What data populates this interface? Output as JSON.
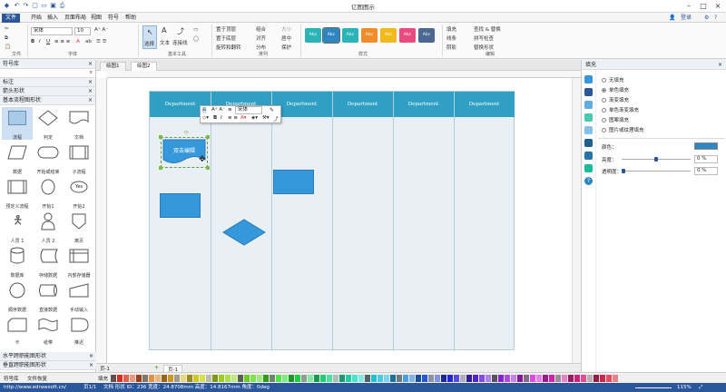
{
  "app": {
    "title": "亿图图示"
  },
  "menu": {
    "tabs": [
      "文件",
      "开始",
      "插入",
      "页面布局",
      "视图",
      "符号",
      "帮助"
    ],
    "login": "登录"
  },
  "ribbon": {
    "font_family": "宋体",
    "font_size": "10",
    "groups": [
      "文件",
      "字体",
      "基本工具",
      "排列",
      "样式",
      "编辑"
    ],
    "tools": {
      "select": "选择",
      "text": "文本",
      "connector": "连接线"
    },
    "arrange": [
      "置于顶层",
      "置于底层",
      "旋转和翻转",
      "组合",
      "对齐",
      "分布",
      "大小",
      "居中",
      "保护"
    ],
    "style_swatch_label": "Abc",
    "style_colors": [
      "#2bb3b8",
      "#2e86c1",
      "#2bb3b8",
      "#f08c2a",
      "#f2b91a",
      "#e84a7f",
      "#4a6891"
    ],
    "edit": [
      "填充",
      "线条",
      "阴影",
      "查找 & 替换",
      "拼写检查",
      "替换形状"
    ]
  },
  "library": {
    "title": "符号库",
    "sections": [
      "标注",
      "箭头形状",
      "基本流程图形状"
    ],
    "shapes": [
      "流程",
      "判定",
      "文档",
      "数据",
      "开始或结束",
      "子流程",
      "预定义流程",
      "开始1",
      "开始2",
      "人员 1",
      "人员 2",
      "离页",
      "数据库",
      "存储数据",
      "内部存储器",
      "顺序数据",
      "直接数据",
      "手动输入",
      "卡",
      "纸带",
      "推迟"
    ],
    "yes_label": "Yes",
    "bottom_sections": [
      "水平跨职能图形状",
      "垂直跨职能图形状"
    ],
    "tabs": [
      "符号库",
      "文件恢复"
    ]
  },
  "doc_tabs": [
    "绘图1",
    "绘图2"
  ],
  "diagram": {
    "lane_header": "Department",
    "lane_count": 6,
    "selected_shape_text": "双击编辑",
    "mini_toolbar_font": "宋体"
  },
  "fill_panel": {
    "title": "填充",
    "options": [
      "无填充",
      "单色填充",
      "渐变填充",
      "单色渐变填充",
      "图案填充",
      "图片或纹理填充"
    ],
    "selected_option": 1,
    "color_label": "颜色：",
    "color_value": "#2e86c1",
    "brightness_label": "亮度：",
    "brightness_value": "0 %",
    "transparency_label": "透明度：",
    "transparency_value": "0 %"
  },
  "page_bar": {
    "page_label": "页-1",
    "page_tab": "页-1"
  },
  "palette": {
    "label": "填充"
  },
  "status": {
    "url": "http://www.edrawsoft.cn/",
    "page": "页1/1",
    "info": "文档 形状 ID：236  宽度：24.8708mm  高度：14.8167mm  角度：0deg",
    "zoom": "115%"
  }
}
